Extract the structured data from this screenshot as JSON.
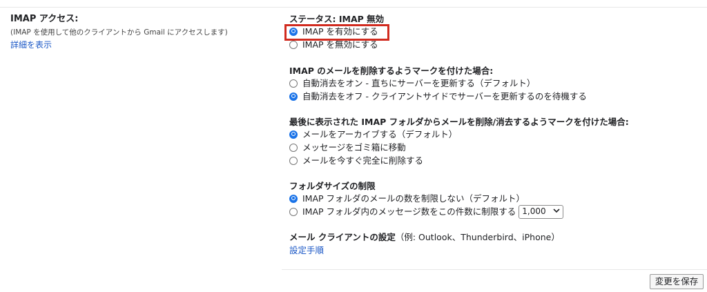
{
  "imap_section": {
    "title": "IMAP アクセス:",
    "description": "(IMAP を使用して他のクライアントから Gmail にアクセスします)",
    "learn_more": "詳細を表示"
  },
  "status": {
    "title": "ステータス: IMAP 無効",
    "options": [
      {
        "label": "IMAP を有効にする",
        "selected": true
      },
      {
        "label": "IMAP を無効にする",
        "selected": false
      }
    ]
  },
  "delete_mark": {
    "title": "IMAP のメールを削除するようマークを付けた場合:",
    "options": [
      {
        "label": "自動消去をオン - 直ちにサーバーを更新する（デフォルト）",
        "selected": false
      },
      {
        "label": "自動消去をオフ - クライアントサイドでサーバーを更新するのを待機する",
        "selected": true
      }
    ]
  },
  "expunge": {
    "title": "最後に表示された IMAP フォルダからメールを削除/消去するようマークを付けた場合:",
    "options": [
      {
        "label": "メールをアーカイブする（デフォルト）",
        "selected": true
      },
      {
        "label": "メッセージをゴミ箱に移動",
        "selected": false
      },
      {
        "label": "メールを今すぐ完全に削除する",
        "selected": false
      }
    ]
  },
  "folder_size": {
    "title": "フォルダサイズの制限",
    "options": [
      {
        "label": "IMAP フォルダのメールの数を制限しない（デフォルト）",
        "selected": true
      },
      {
        "label": "IMAP フォルダ内のメッセージ数をこの件数に制限する",
        "selected": false
      }
    ],
    "limit_value": "1,000"
  },
  "client": {
    "title": "メール クライアントの設定",
    "examples": "（例: Outlook、Thunderbird、iPhone）",
    "setup_link": "設定手順"
  },
  "footer": {
    "save_label": "変更を保存"
  },
  "colors": {
    "accent": "#1a73e8",
    "link": "#1a57c6",
    "highlight_border": "#d12b1f"
  },
  "icons": {
    "dropdown": "chevron-down-icon"
  }
}
